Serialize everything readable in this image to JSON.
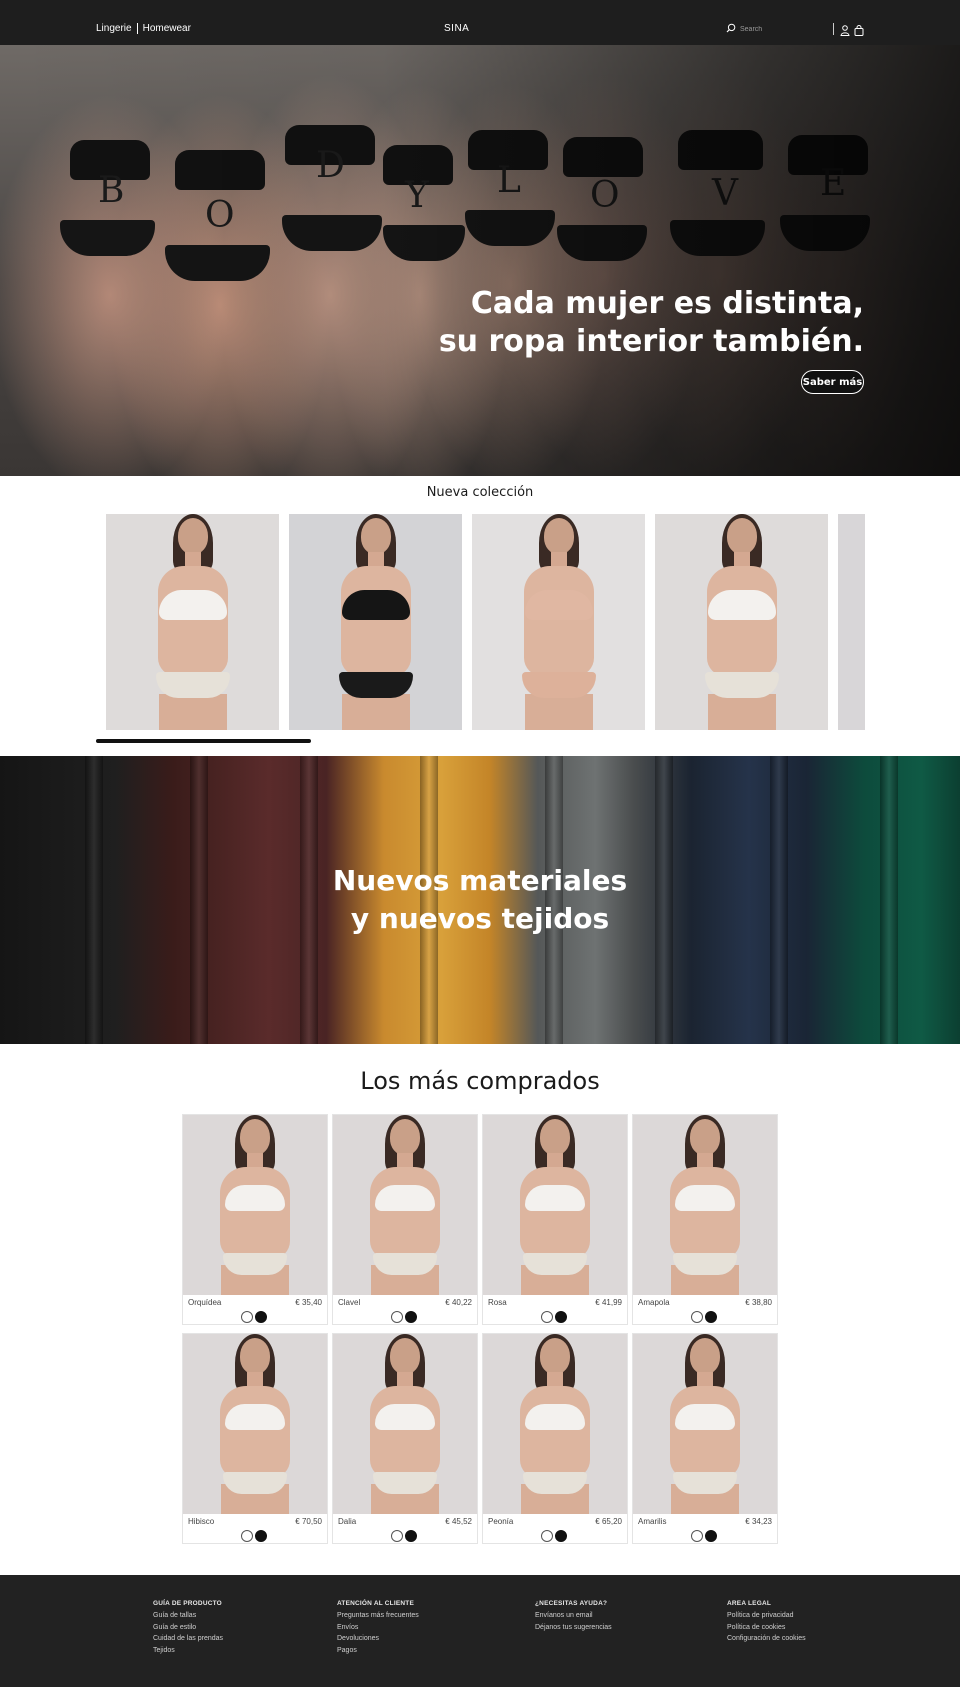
{
  "header": {
    "left_links": [
      "Lingerie",
      "Homewear"
    ],
    "brand": "SINA",
    "search_placeholder": "Search"
  },
  "hero": {
    "title_line1": "Cada mujer es distinta,",
    "title_line2": "su ropa interior también.",
    "cta": "Saber más",
    "body_letters": [
      "B",
      "O",
      "D",
      "Y",
      "L",
      "O",
      "V",
      "E"
    ]
  },
  "new_collection": {
    "title": "Nueva colección"
  },
  "materials": {
    "title_line1": "Nuevos materiales",
    "title_line2": "y nuevos tejidos"
  },
  "best_sellers": {
    "title": "Los más comprados",
    "products": [
      {
        "name": "Orquídea",
        "price": "€ 35,40"
      },
      {
        "name": "Clavel",
        "price": "€ 40,22"
      },
      {
        "name": "Rosa",
        "price": "€ 41,99"
      },
      {
        "name": "Amapola",
        "price": "€ 38,80"
      },
      {
        "name": "Hibisco",
        "price": "€ 70,50"
      },
      {
        "name": "Dalia",
        "price": "€ 45,52"
      },
      {
        "name": "Peonía",
        "price": "€ 65,20"
      },
      {
        "name": "Amarilis",
        "price": "€ 34,23"
      }
    ]
  },
  "footer": {
    "columns": [
      {
        "title": "GUÍA DE PRODUCTO",
        "links": [
          "Guía de tallas",
          "Guía de estilo",
          "Cuidad de las prendas",
          "Tejidos"
        ]
      },
      {
        "title": "ATENCIÓN AL CLIENTE",
        "links": [
          "Preguntas más frecuentes",
          "Envíos",
          "Devoluciones",
          "Pagos"
        ]
      },
      {
        "title": "¿NECESITAS AYUDA?",
        "links": [
          "Envíanos un email",
          "Déjanos tus sugerencias"
        ]
      },
      {
        "title": "AREA LEGAL",
        "links": [
          "Política de privacidad",
          "Política de cookies",
          "Configuración de cookies"
        ]
      }
    ]
  },
  "colors": {
    "topbar": "#1e1e1e",
    "footer": "#222222",
    "accent": "#111111"
  },
  "icons": [
    "search-icon",
    "user-icon",
    "shopping-bag-icon"
  ]
}
